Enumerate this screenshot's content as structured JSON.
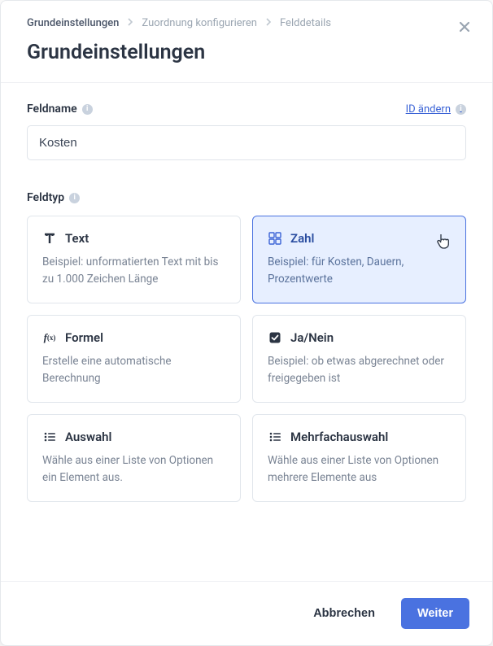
{
  "breadcrumb": {
    "items": [
      {
        "label": "Grundeinstellungen",
        "active": true
      },
      {
        "label": "Zuordnung konfigurieren",
        "active": false
      },
      {
        "label": "Felddetails",
        "active": false
      }
    ]
  },
  "title": "Grundeinstellungen",
  "fieldname": {
    "label": "Feldname",
    "change_id_label": "ID ändern",
    "value": "Kosten"
  },
  "fieldtype": {
    "label": "Feldtyp",
    "options": [
      {
        "key": "text",
        "title": "Text",
        "desc": "Beispiel: unformatierten Text mit bis zu 1.000 Zeichen Länge",
        "icon": "text-icon",
        "selected": false
      },
      {
        "key": "number",
        "title": "Zahl",
        "desc": "Beispiel: für Kosten, Dauern, Prozentwerte",
        "icon": "number-icon",
        "selected": true
      },
      {
        "key": "formula",
        "title": "Formel",
        "desc": "Erstelle eine automatische Berechnung",
        "icon": "formula-icon",
        "selected": false
      },
      {
        "key": "boolean",
        "title": "Ja/Nein",
        "desc": "Beispiel: ob etwas abgerechnet oder freigegeben ist",
        "icon": "checkbox-icon",
        "selected": false
      },
      {
        "key": "select",
        "title": "Auswahl",
        "desc": "Wähle aus einer Liste von Optionen ein Element aus.",
        "icon": "list-icon",
        "selected": false
      },
      {
        "key": "multiselect",
        "title": "Mehrfachauswahl",
        "desc": "Wähle aus einer Liste von Optionen mehrere Elemente aus",
        "icon": "list-icon",
        "selected": false
      }
    ]
  },
  "footer": {
    "cancel": "Abbrechen",
    "next": "Weiter"
  }
}
